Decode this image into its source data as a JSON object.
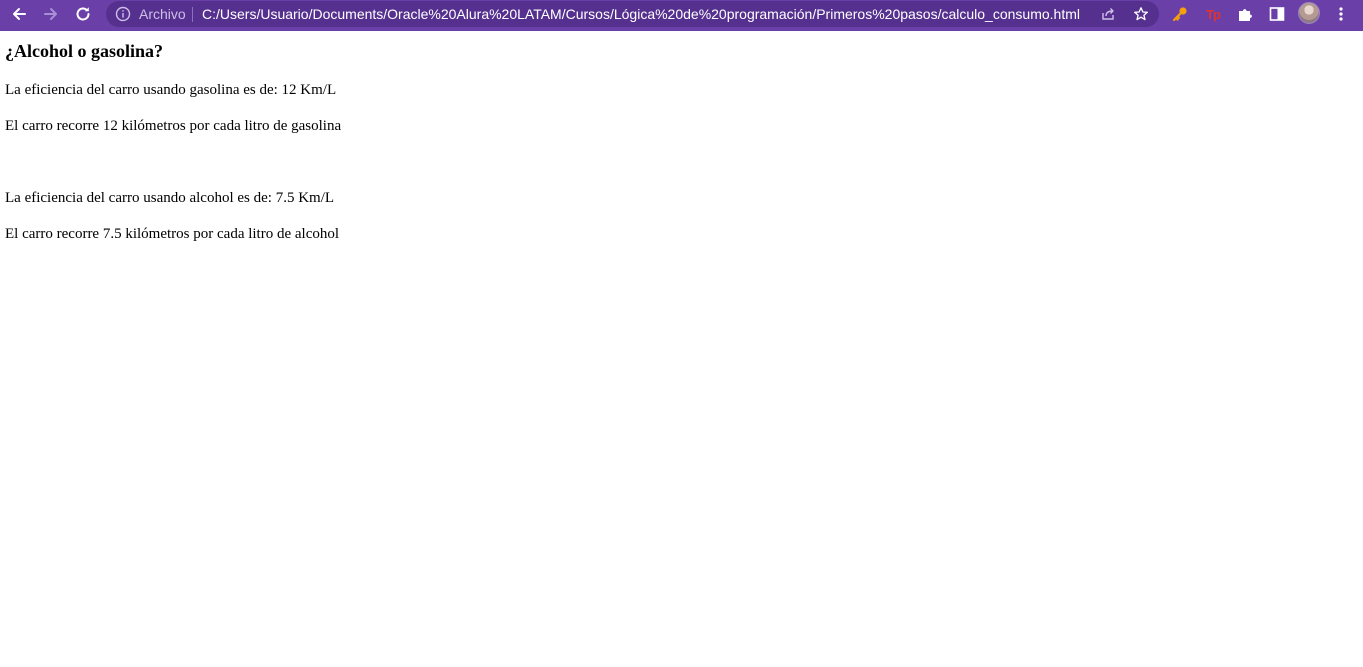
{
  "browser": {
    "scheme_label": "Archivo",
    "url": "C:/Users/Usuario/Documents/Oracle%20Alura%20LATAM/Cursos/Lógica%20de%20programación/Primeros%20pasos/calculo_consumo.html",
    "toolbar_color": "#6a40a8",
    "omnibox_color": "#55308f",
    "extension_tp_label": "Tp"
  },
  "page": {
    "heading": "¿Alcohol o gasolina?",
    "lines": [
      "La eficiencia del carro usando gasolina es de: 12 Km/L",
      "El carro recorre 12 kilómetros por cada litro de gasolina",
      "La eficiencia del carro usando alcohol es de: 7.5 Km/L",
      "El carro recorre 7.5 kilómetros por cada litro de alcohol"
    ]
  }
}
